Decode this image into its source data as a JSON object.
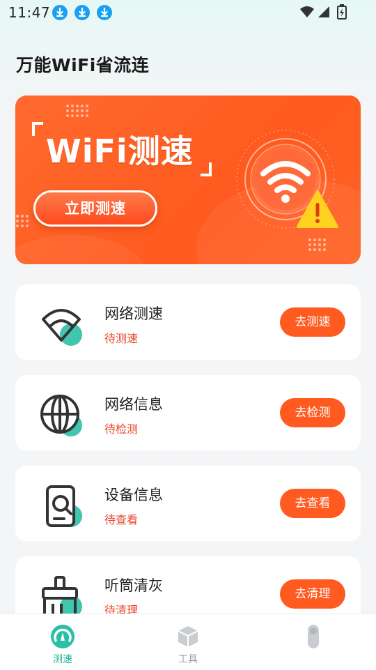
{
  "status_bar": {
    "time": "11:47"
  },
  "app": {
    "title": "万能WiFi省流连"
  },
  "banner": {
    "title": "WiFi测速",
    "button_label": "立即测速"
  },
  "cards": [
    {
      "title": "网络测速",
      "status": "待测速",
      "button": "去测速",
      "icon": "wifi-icon"
    },
    {
      "title": "网络信息",
      "status": "待检测",
      "button": "去检测",
      "icon": "globe-icon"
    },
    {
      "title": "设备信息",
      "status": "待查看",
      "button": "去查看",
      "icon": "phone-search-icon"
    },
    {
      "title": "听筒清灰",
      "status": "待清理",
      "button": "去清理",
      "icon": "brush-icon"
    }
  ],
  "nav": [
    {
      "label": "测速",
      "active": true,
      "icon": "speed-gauge-icon"
    },
    {
      "label": "工具",
      "active": false,
      "icon": "box-icon"
    },
    {
      "label": "",
      "active": false,
      "icon": "profile-icon"
    }
  ],
  "colors": {
    "accent": "#ff5a1f",
    "status_text": "#e8462a",
    "teal": "#2bbfa5"
  }
}
